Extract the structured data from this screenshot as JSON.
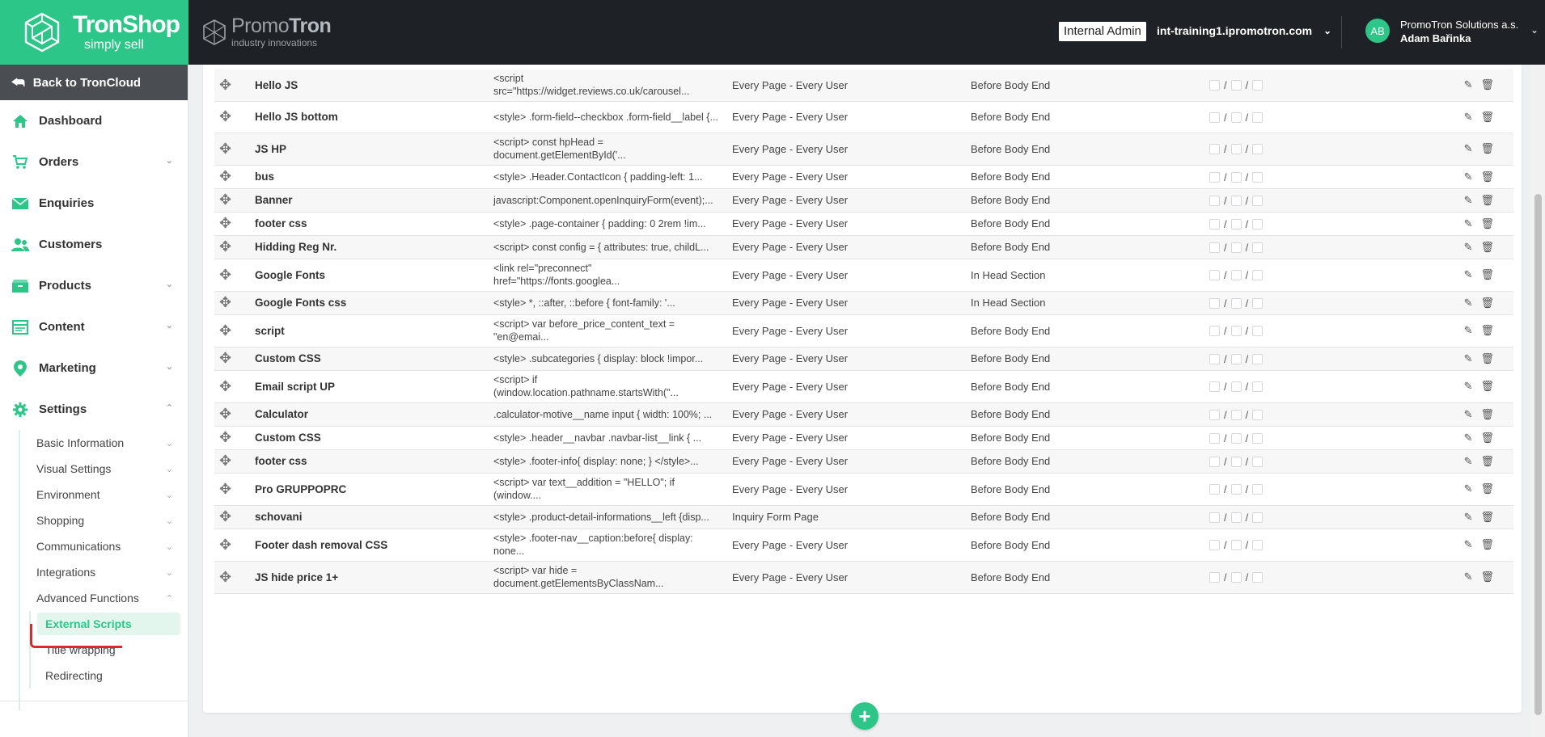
{
  "brand": {
    "name": "TronShop",
    "tagline": "simply sell"
  },
  "partner": {
    "name_light": "Promo",
    "name_bold": "Tron",
    "tagline": "industry innovations"
  },
  "header": {
    "admin_badge": "Internal Admin",
    "domain": "int-training1.ipromotron.com",
    "avatar_initials": "AB",
    "company": "PromoTron Solutions a.s.",
    "user": "Adam Bařinka"
  },
  "sidebar": {
    "back": "Back to TronCloud",
    "items": [
      {
        "label": "Dashboard",
        "icon": "home-icon"
      },
      {
        "label": "Orders",
        "icon": "cart-icon"
      },
      {
        "label": "Enquiries",
        "icon": "envelope-icon"
      },
      {
        "label": "Customers",
        "icon": "users-icon"
      },
      {
        "label": "Products",
        "icon": "box-icon"
      },
      {
        "label": "Content",
        "icon": "layout-icon"
      },
      {
        "label": "Marketing",
        "icon": "map-pin-icon"
      },
      {
        "label": "Settings",
        "icon": "gear-icon"
      }
    ],
    "settings_sub": [
      "Basic Information",
      "Visual Settings",
      "Environment",
      "Shopping",
      "Communications",
      "Integrations",
      "Advanced Functions"
    ],
    "advanced_sub": [
      "External Scripts",
      "Title wrapping",
      "Redirecting"
    ]
  },
  "scripts": [
    {
      "name": "Hello JS",
      "code": "<script src=\"https://widget.reviews.co.uk/carousel...",
      "target": "Every Page - Every User",
      "placement": "Before Body End"
    },
    {
      "name": "Hello JS bottom",
      "code": "<style> .form-field--checkbox .form-field__label {...",
      "target": "Every Page - Every User",
      "placement": "Before Body End"
    },
    {
      "name": "JS HP",
      "code": "<script> const hpHead = document.getElementById('...",
      "target": "Every Page - Every User",
      "placement": "Before Body End"
    },
    {
      "name": "bus",
      "code": "<style> .Header.ContactIcon { padding-left: 1...",
      "target": "Every Page - Every User",
      "placement": "Before Body End"
    },
    {
      "name": "Banner",
      "code": "javascript:Component.openInquiryForm(event);...",
      "target": "Every Page - Every User",
      "placement": "Before Body End"
    },
    {
      "name": "footer css",
      "code": "<style> .page-container { padding: 0 2rem !im...",
      "target": "Every Page - Every User",
      "placement": "Before Body End"
    },
    {
      "name": "Hidding Reg Nr.",
      "code": "<script> const config = { attributes: true, childL...",
      "target": "Every Page - Every User",
      "placement": "Before Body End"
    },
    {
      "name": "Google Fonts",
      "code": "<link rel=\"preconnect\" href=\"https://fonts.googlea...",
      "target": "Every Page - Every User",
      "placement": "In Head Section"
    },
    {
      "name": "Google Fonts css",
      "code": "<style> *, ::after, ::before { font-family: '...",
      "target": "Every Page - Every User",
      "placement": "In Head Section"
    },
    {
      "name": "script",
      "code": "<script> var before_price_content_text = \"en@emai...",
      "target": "Every Page - Every User",
      "placement": "Before Body End"
    },
    {
      "name": "Custom CSS",
      "code": "<style> .subcategories { display: block !impor...",
      "target": "Every Page - Every User",
      "placement": "Before Body End"
    },
    {
      "name": "Email script UP",
      "code": "<script> if (window.location.pathname.startsWith(\"...",
      "target": "Every Page - Every User",
      "placement": "Before Body End"
    },
    {
      "name": "Calculator",
      "code": ".calculator-motive__name input { width: 100%; ...",
      "target": "Every Page - Every User",
      "placement": "Before Body End"
    },
    {
      "name": "Custom CSS",
      "code": "<style> .header__navbar .navbar-list__link { ...",
      "target": "Every Page - Every User",
      "placement": "Before Body End"
    },
    {
      "name": "footer css",
      "code": "<style> .footer-info{ display: none; } </style>...",
      "target": "Every Page - Every User",
      "placement": "Before Body End"
    },
    {
      "name": "Pro GRUPPOPRC",
      "code": "<script> var text__addition = \"HELLO\"; if (window....",
      "target": "Every Page - Every User",
      "placement": "Before Body End"
    },
    {
      "name": "schovani",
      "code": "<style> .product-detail-informations__left {disp...",
      "target": "Inquiry Form Page",
      "placement": "Before Body End"
    },
    {
      "name": "Footer dash removal CSS",
      "code": "<style> .footer-nav__caption:before{ display: none...",
      "target": "Every Page - Every User",
      "placement": "Before Body End"
    },
    {
      "name": "JS hide price 1+",
      "code": "<script> var hide = document.getElementsByClassNam...",
      "target": "Every Page - Every User",
      "placement": "Before Body End"
    }
  ],
  "flag_separator": "/",
  "icons": {
    "drag": "✥",
    "edit": "✎",
    "delete": "🗑",
    "add": "+"
  },
  "colors": {
    "brand": "#2dc689",
    "topbar": "#1e2226",
    "back_bar": "#4a4d51",
    "highlight": "#e0252d"
  }
}
